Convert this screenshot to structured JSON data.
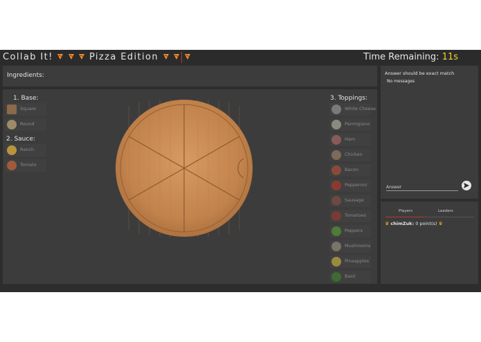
{
  "header": {
    "title_left": "Collab It!",
    "title_right": "Pizza Edition",
    "timer_label": "Time Remaining:",
    "timer_value": "11s"
  },
  "ingredients_label": "Ingredients:",
  "sections": {
    "base_title": "1. Base:",
    "sauce_title": "2. Sauce:",
    "toppings_title": "3. Toppings:"
  },
  "bases": [
    "Square",
    "Round"
  ],
  "sauces": [
    "Ranch",
    "Tomato"
  ],
  "toppings": [
    "White Cheese",
    "Parmigiano",
    "Ham",
    "Chicken",
    "Bacon",
    "Pepperoni",
    "Sausage",
    "Tomatoes",
    "Peppers",
    "Mushrooms",
    "Pineapples",
    "Basil"
  ],
  "chat": {
    "hint": "Answer should be exact match",
    "empty": "No messages",
    "answer_placeholder": "Answer"
  },
  "score_tabs": [
    "Players",
    "Leaders"
  ],
  "player": {
    "name": "chimZuk:",
    "points": "0 point(s)"
  },
  "colors": {
    "accent": "#c0392b",
    "timer": "#f2d230",
    "wood": "#c98a55"
  }
}
